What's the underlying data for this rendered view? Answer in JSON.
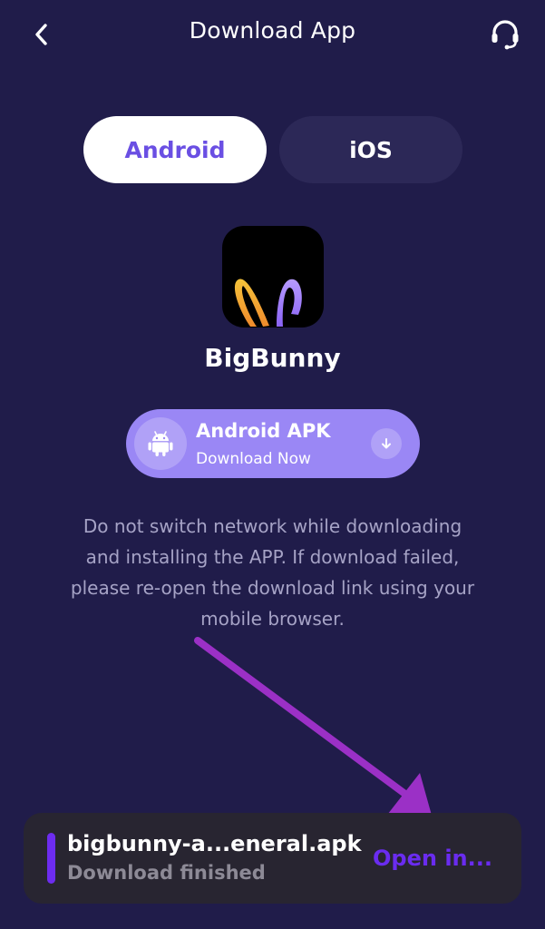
{
  "header": {
    "title": "Download App",
    "back_icon": "chevron-left-icon",
    "support_icon": "headset-icon"
  },
  "tabs": [
    {
      "label": "Android",
      "selected": true
    },
    {
      "label": "iOS",
      "selected": false
    }
  ],
  "app": {
    "name": "BigBunny",
    "icon": "bunny-ears-logo"
  },
  "download_button": {
    "title": "Android APK",
    "subtitle": "Download Now",
    "left_icon": "android-icon",
    "right_icon": "arrow-down-icon"
  },
  "notice": {
    "text": "Do not switch network while downloading and installing the APP. If download failed, please re-open the download link using your mobile browser."
  },
  "toast": {
    "filename": "bigbunny-a...eneral.apk",
    "status": "Download finished",
    "action_label": "Open in..."
  },
  "colors": {
    "background": "#201c4a",
    "accent": "#6a4fe3",
    "button": "#9a87f5",
    "toast_accent": "#6a2cf0",
    "annotation_arrow": "#9b30c6"
  }
}
